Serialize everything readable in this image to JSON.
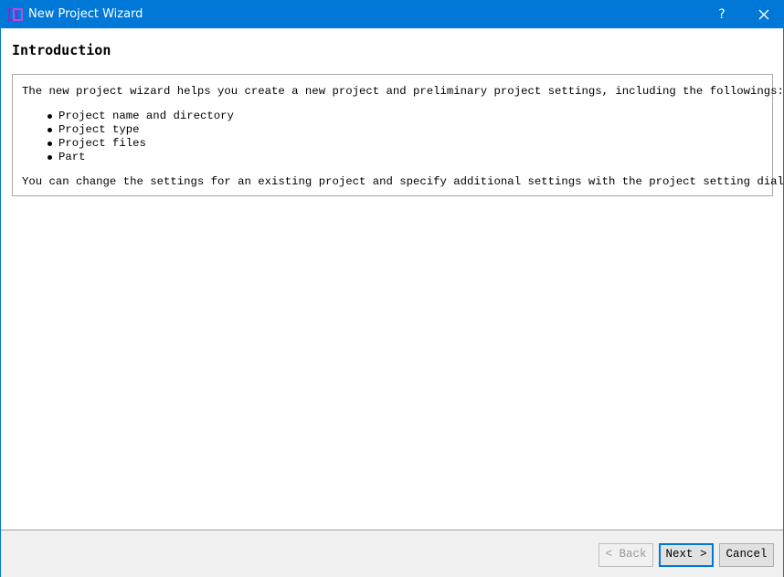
{
  "window": {
    "title": "New Project Wizard",
    "help_label": "?",
    "accent_color": "#0078d7"
  },
  "icons": {
    "app": "app-logo-icon",
    "close": "close-icon"
  },
  "page": {
    "heading": "Introduction",
    "intro_text": "The new project wizard helps you create a new project and preliminary project settings, including the followings:",
    "items": [
      "Project name and directory",
      "Project type",
      "Project files",
      "Part"
    ],
    "footer_text": "You can change the settings for an existing project and specify additional settings with the project setting dialog."
  },
  "buttons": {
    "back": "< Back",
    "back_enabled": false,
    "next": "Next >",
    "cancel": "Cancel"
  }
}
